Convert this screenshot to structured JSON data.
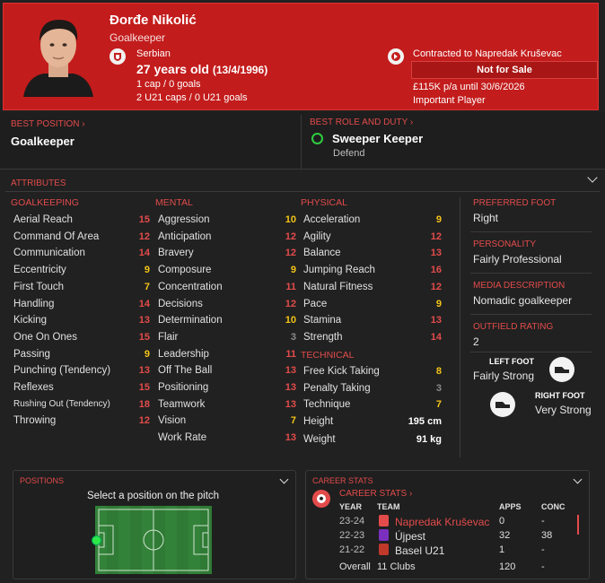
{
  "player": {
    "name": "Đorđe Nikolić",
    "position": "Goalkeeper",
    "nationality": "Serbian",
    "age_text": "27 years old",
    "dob": "(13/4/1996)",
    "caps": "1 cap / 0 goals",
    "u21_caps": "2 U21 caps / 0 U21 goals"
  },
  "contract": {
    "club": "Contracted to Napredak Kruševac",
    "status": "Not for Sale",
    "wage": "£115K p/a until 30/6/2026",
    "squad_status": "Important Player"
  },
  "best_position": {
    "label": "BEST POSITION",
    "value": "Goalkeeper"
  },
  "best_role": {
    "label": "BEST ROLE AND DUTY",
    "role": "Sweeper Keeper",
    "duty": "Defend"
  },
  "attributes_label": "ATTRIBUTES",
  "goalkeeping": {
    "title": "GOALKEEPING",
    "items": [
      {
        "name": "Aerial Reach",
        "value": "15",
        "color": "#e34b4b"
      },
      {
        "name": "Command Of Area",
        "value": "12",
        "color": "#e34b4b"
      },
      {
        "name": "Communication",
        "value": "14",
        "color": "#e34b4b"
      },
      {
        "name": "Eccentricity",
        "value": "9",
        "color": "#f5c518"
      },
      {
        "name": "First Touch",
        "value": "7",
        "color": "#f5c518"
      },
      {
        "name": "Handling",
        "value": "14",
        "color": "#e34b4b"
      },
      {
        "name": "Kicking",
        "value": "13",
        "color": "#e34b4b"
      },
      {
        "name": "One On Ones",
        "value": "15",
        "color": "#e34b4b"
      },
      {
        "name": "Passing",
        "value": "9",
        "color": "#f5c518"
      },
      {
        "name": "Punching (Tendency)",
        "value": "13",
        "color": "#e34b4b"
      },
      {
        "name": "Reflexes",
        "value": "15",
        "color": "#e34b4b"
      },
      {
        "name": "Rushing Out (Tendency)",
        "value": "18",
        "color": "#e34b4b"
      },
      {
        "name": "Throwing",
        "value": "12",
        "color": "#e34b4b"
      }
    ]
  },
  "mental": {
    "title": "MENTAL",
    "items": [
      {
        "name": "Aggression",
        "value": "10",
        "color": "#f5c518"
      },
      {
        "name": "Anticipation",
        "value": "12",
        "color": "#e34b4b"
      },
      {
        "name": "Bravery",
        "value": "12",
        "color": "#e34b4b"
      },
      {
        "name": "Composure",
        "value": "9",
        "color": "#f5c518"
      },
      {
        "name": "Concentration",
        "value": "11",
        "color": "#e34b4b"
      },
      {
        "name": "Decisions",
        "value": "12",
        "color": "#e34b4b"
      },
      {
        "name": "Determination",
        "value": "10",
        "color": "#f5c518"
      },
      {
        "name": "Flair",
        "value": "3",
        "color": "#8a8a8a"
      },
      {
        "name": "Leadership",
        "value": "11",
        "color": "#e34b4b"
      },
      {
        "name": "Off The Ball",
        "value": "13",
        "color": "#e34b4b"
      },
      {
        "name": "Positioning",
        "value": "13",
        "color": "#e34b4b"
      },
      {
        "name": "Teamwork",
        "value": "13",
        "color": "#e34b4b"
      },
      {
        "name": "Vision",
        "value": "7",
        "color": "#f5c518"
      },
      {
        "name": "Work Rate",
        "value": "13",
        "color": "#e34b4b"
      }
    ]
  },
  "physical": {
    "title": "PHYSICAL",
    "items": [
      {
        "name": "Acceleration",
        "value": "9",
        "color": "#f5c518"
      },
      {
        "name": "Agility",
        "value": "12",
        "color": "#e34b4b"
      },
      {
        "name": "Balance",
        "value": "13",
        "color": "#e34b4b"
      },
      {
        "name": "Jumping Reach",
        "value": "16",
        "color": "#e34b4b"
      },
      {
        "name": "Natural Fitness",
        "value": "12",
        "color": "#e34b4b"
      },
      {
        "name": "Pace",
        "value": "9",
        "color": "#f5c518"
      },
      {
        "name": "Stamina",
        "value": "13",
        "color": "#e34b4b"
      },
      {
        "name": "Strength",
        "value": "14",
        "color": "#e34b4b"
      }
    ]
  },
  "technical": {
    "title": "TECHNICAL",
    "items": [
      {
        "name": "Free Kick Taking",
        "value": "8",
        "color": "#f5c518"
      },
      {
        "name": "Penalty Taking",
        "value": "3",
        "color": "#8a8a8a"
      },
      {
        "name": "Technique",
        "value": "7",
        "color": "#f5c518"
      }
    ]
  },
  "measures": {
    "height_label": "Height",
    "height": "195 cm",
    "weight_label": "Weight",
    "weight": "91 kg"
  },
  "side": {
    "foot_label": "PREFERRED FOOT",
    "foot": "Right",
    "personality_label": "PERSONALITY",
    "personality": "Fairly Professional",
    "media_label": "MEDIA DESCRIPTION",
    "media": "Nomadic goalkeeper",
    "outfield_label": "OUTFIELD RATING",
    "outfield": "2",
    "left_foot_label": "LEFT FOOT",
    "left_foot": "Fairly Strong",
    "right_foot_label": "RIGHT FOOT",
    "right_foot": "Very Strong"
  },
  "positions": {
    "title": "POSITIONS",
    "hint": "Select a position on the pitch"
  },
  "career": {
    "title": "CAREER STATS",
    "link": "CAREER STATS",
    "headers": {
      "year": "YEAR",
      "team": "TEAM",
      "apps": "APPS",
      "conc": "CONC"
    },
    "rows": [
      {
        "year": "23-24",
        "team": "Napredak Kruševac",
        "apps": "0",
        "conc": "-",
        "highlight": true
      },
      {
        "year": "22-23",
        "team": "Újpest",
        "apps": "32",
        "conc": "38",
        "highlight": false
      },
      {
        "year": "21-22",
        "team": "Basel U21",
        "apps": "1",
        "conc": "-",
        "highlight": false
      }
    ],
    "overall": {
      "label": "Overall",
      "team": "11 Clubs",
      "apps": "120",
      "conc": "-"
    }
  },
  "colors": {
    "accent": "#e34b4b",
    "header_bg": "#c31c1c",
    "good": "#f5c518"
  },
  "icons": [
    "serbia-flag-icon",
    "club-crest-icon",
    "green-ring-icon",
    "boot-icon",
    "chevron-down-icon",
    "sort-icon"
  ]
}
